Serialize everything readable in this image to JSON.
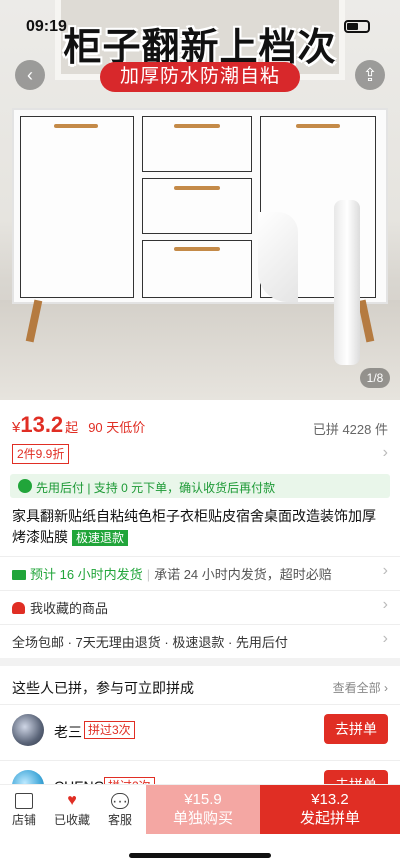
{
  "status_bar": {
    "time": "09:19"
  },
  "hero": {
    "headline": "柜子翻新上档次",
    "sub_banner": "加厚防水防潮自粘",
    "back_icon": "chevron-left-icon",
    "share_icon": "share-icon",
    "page_counter": "1/8"
  },
  "price": {
    "currency": "¥",
    "amount": "13.2",
    "suffix": "起",
    "low_price_tag": "90 天低价",
    "group_count": "已拼 4228 件",
    "coupon": "2件9.9折"
  },
  "pay_later": {
    "text": "先用后付 | 支持 0 元下单，确认收货后再付款"
  },
  "product": {
    "title": "家具翻新贴纸自粘纯色柜子衣柜贴皮宿舍桌面改造装饰加厚烤漆贴膜",
    "badge": "极速退款"
  },
  "shipping": {
    "lead": "预计 16 小时内发货",
    "promise": "承诺 24 小时内发货，超时必赔"
  },
  "favorites_row": {
    "text": "我收藏的商品"
  },
  "services_row": {
    "text": "全场包邮 · 7天无理由退货 · 极速退款 · 先用后付"
  },
  "group_section": {
    "title": "这些人已拼，参与可立即拼成",
    "view_all": "查看全部",
    "members": [
      {
        "name": "老三",
        "tag": "拼过3次",
        "button": "去拼单"
      },
      {
        "name": "CHENG",
        "tag": "拼过2次",
        "button": "去拼单"
      }
    ]
  },
  "bottom_bar": {
    "store": "店铺",
    "favorited": "已收藏",
    "service": "客服",
    "buy_alone_price": "¥15.9",
    "buy_alone_label": "单独购买",
    "buy_group_price": "¥13.2",
    "buy_group_label": "发起拼单"
  },
  "colors": {
    "accent": "#e02e24",
    "green": "#21a53a",
    "buy_alone_bg": "#f4a7a3"
  }
}
